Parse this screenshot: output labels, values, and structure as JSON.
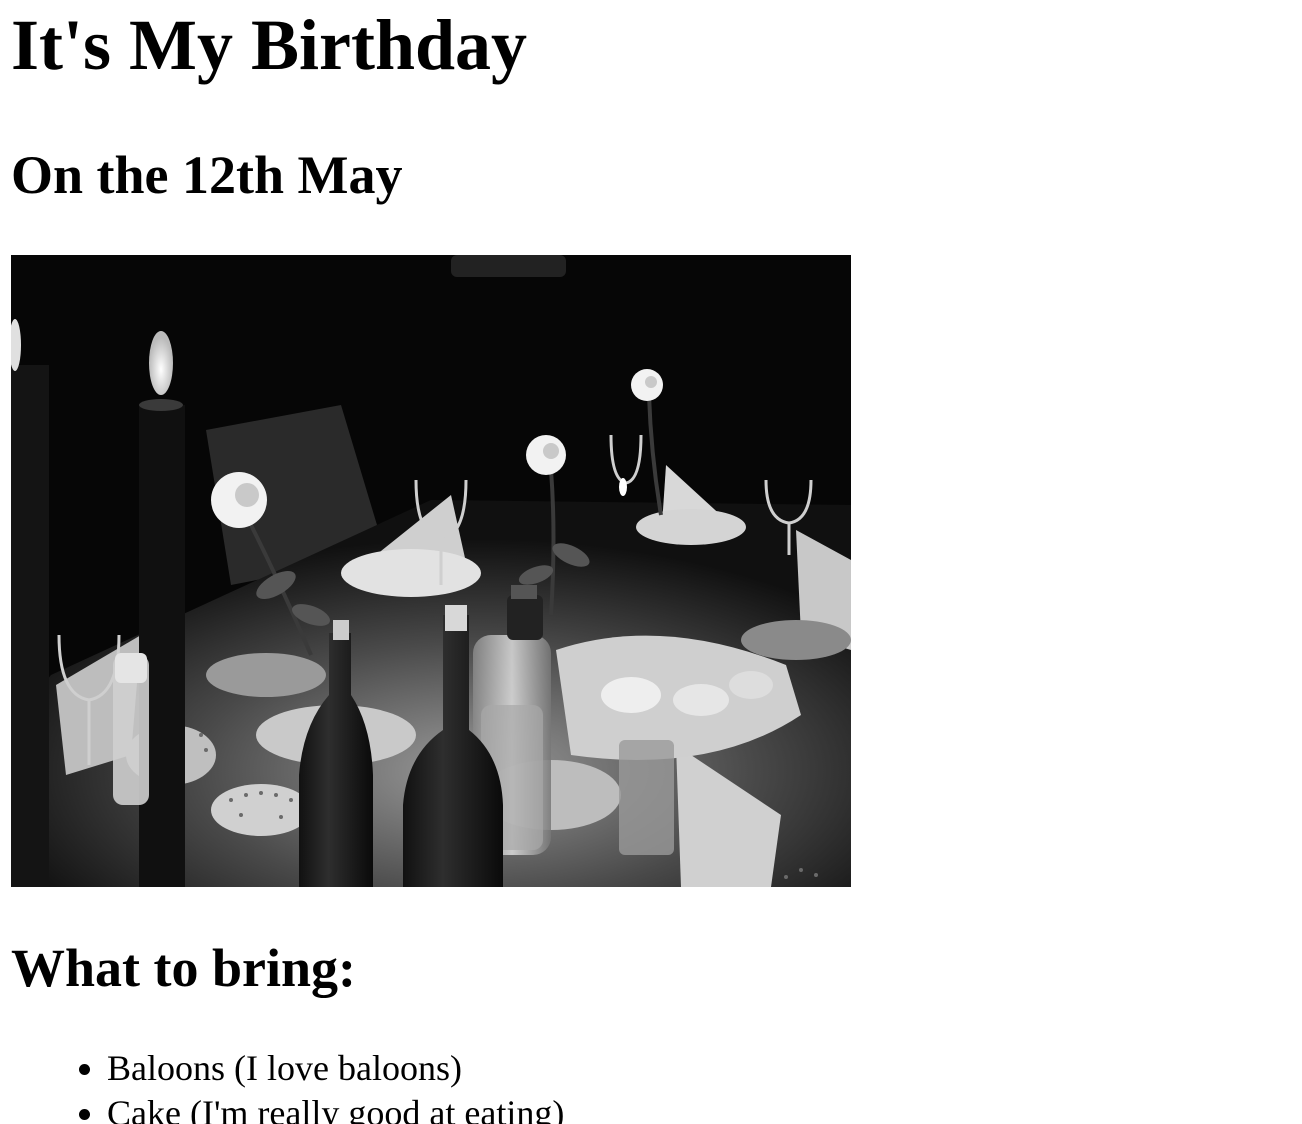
{
  "page": {
    "title": "It's My Birthday",
    "date_heading": "On the 12th May",
    "photo_alt": "Dinner table with candles, roses, wine bottles and plates",
    "bring_heading": "What to bring:",
    "items": [
      "Baloons (I love baloons)",
      "Cake (I'm really good at eating)"
    ]
  }
}
